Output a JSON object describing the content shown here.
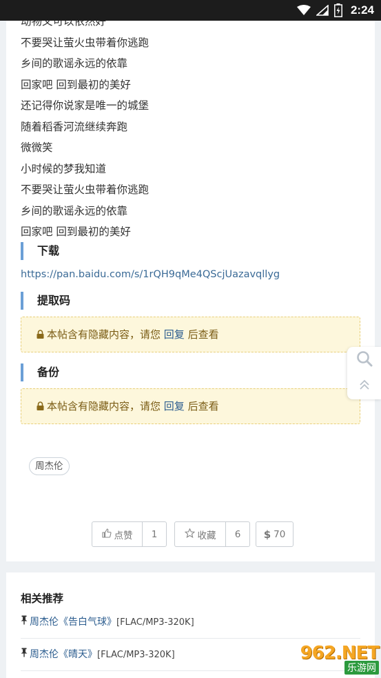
{
  "status_bar": {
    "time": "2:24"
  },
  "lyrics": [
    "动物又可以依然好",
    "不要哭让萤火虫带着你逃跑",
    "乡间的歌谣永远的依靠",
    "回家吧 回到最初的美好",
    "还记得你说家是唯一的城堡",
    "随着稻香河流继续奔跑",
    "微微笑",
    "小时候的梦我知道",
    "不要哭让萤火虫带着你逃跑",
    "乡间的歌谣永远的依靠",
    "回家吧 回到最初的美好"
  ],
  "sections": {
    "download": {
      "heading": "下载",
      "link": "https://pan.baidu.com/s/1rQH9qMe4QScjUazavqllyg"
    },
    "extract_code": {
      "heading": "提取码"
    },
    "backup": {
      "heading": "备份"
    }
  },
  "hidden_notice": {
    "before": "本帖含有隐藏内容，请您",
    "reply_link": "回复",
    "after": "后查看"
  },
  "tag": "周杰伦",
  "actions": {
    "like_label": "点赞",
    "like_count": "1",
    "fav_label": "收藏",
    "fav_count": "6",
    "price": "70"
  },
  "related": {
    "title": "相关推荐",
    "items": [
      {
        "link": "周杰伦《告白气球》",
        "format": "[FLAC/MP3-320K]"
      },
      {
        "link": "周杰伦《晴天》",
        "format": "[FLAC/MP3-320K]"
      }
    ]
  },
  "watermark": {
    "main": "962.NET",
    "sub": "乐游网"
  },
  "colors": {
    "accent": "#6b9fd6",
    "link": "#2c5d8f",
    "notice_bg": "#fdf7dc",
    "notice_border": "#e8cf7a"
  },
  "icons": [
    "wifi-icon",
    "signal-icon",
    "battery-icon",
    "lock-icon",
    "thumbs-up-icon",
    "star-icon",
    "dollar-icon",
    "search-icon",
    "chevrons-up-icon",
    "pin-icon"
  ]
}
